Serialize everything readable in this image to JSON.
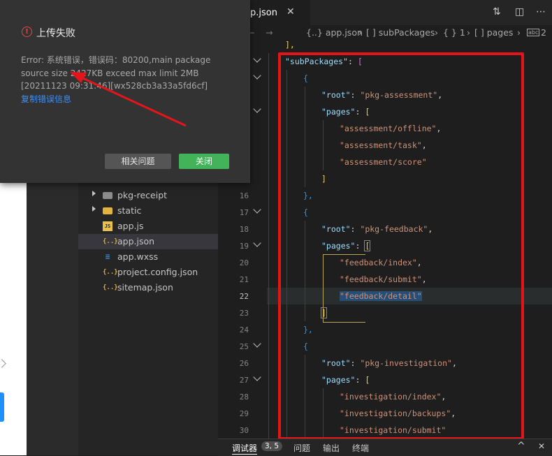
{
  "dialog": {
    "title": "上传失败",
    "message": "Error: 系统错误，错误码：80200,main package source size 2427KB exceed max limit 2MB [20211123 09:31:46][wx528cb3a33a5fd6cf]",
    "copy_link": "复制错误信息",
    "related_button": "相关问题",
    "close_button": "关闭",
    "error_icon": "!"
  },
  "editor": {
    "tab_label": "p.json",
    "tab_close": "✕",
    "breadcrumb": {
      "part1": "{..} app.json",
      "sep1": "›",
      "part2": "[ ] subPackages",
      "sep2": "›",
      "part3": "{ } 1",
      "sep3": "›",
      "part4": "[ ] pages",
      "sep4": "›",
      "part5": "2"
    },
    "breadcrumb_string_icon": "abc"
  },
  "explorer": {
    "items": [
      {
        "label": "pkg-receipt",
        "icon": "folder-icon"
      },
      {
        "label": "static",
        "icon": "folder-icon"
      },
      {
        "label": "app.js",
        "icon": "js-file-icon"
      },
      {
        "label": "app.json",
        "icon": "json-file-icon"
      },
      {
        "label": "app.wxss",
        "icon": "css-file-icon"
      },
      {
        "label": "project.config.json",
        "icon": "json-file-icon"
      },
      {
        "label": "sitemap.json",
        "icon": "json-file-icon"
      }
    ]
  },
  "line_numbers": [
    "16",
    "17",
    "18",
    "19",
    "20",
    "21",
    "22",
    "23",
    "24",
    "25",
    "26",
    "27",
    "28",
    "29",
    "30"
  ],
  "code": {
    "l0_open": "],",
    "l1_key": "\"subPackages\"",
    "l1_colon": ": ",
    "l1_bracket": "[",
    "l2_brace": "{",
    "l3_key": "\"root\"",
    "l3_colon": ": ",
    "l3_val": "\"pkg-assessment\"",
    "l3_comma": ",",
    "l4_key": "\"pages\"",
    "l4_colon": ": ",
    "l4_bracket": "[",
    "l5_val": "\"assessment/offline\"",
    "l5_comma": ",",
    "l6_val": "\"assessment/task\"",
    "l6_comma": ",",
    "l7_val": "\"assessment/score\"",
    "l8_bracket": "]",
    "l9_brace": "},",
    "l10_brace": "{",
    "l11_key": "\"root\"",
    "l11_colon": ": ",
    "l11_val": "\"pkg-feedback\"",
    "l11_comma": ",",
    "l12_key": "\"pages\"",
    "l12_colon": ": ",
    "l12_bracket": "[",
    "l13_val": "\"feedback/index\"",
    "l13_comma": ",",
    "l14_val": "\"feedback/submit\"",
    "l14_comma": ",",
    "l15_val": "\"feedback/detail\"",
    "l16_bracket": "]",
    "l17_brace": "},",
    "l18_brace": "{",
    "l19_key": "\"root\"",
    "l19_colon": ": ",
    "l19_val": "\"pkg-investigation\"",
    "l19_comma": ",",
    "l20_key": "\"pages\"",
    "l20_colon": ": ",
    "l20_bracket": "[",
    "l21_val": "\"investigation/index\"",
    "l21_comma": ",",
    "l22_val": "\"investigation/backups\"",
    "l22_comma": ",",
    "l23_val": "\"investigation/submit\""
  },
  "bottom_panel": {
    "debugger": "调试器",
    "badge": "3, 5",
    "issues": "问题",
    "output": "输出",
    "terminal": "终端",
    "up_icon": "^",
    "close_icon": "✕"
  },
  "colors": {
    "annotation_red": "#e3151a",
    "accent_blue": "#1e90ff",
    "close_green": "#43b35a",
    "json_key": "#9cdcfe",
    "json_string": "#ce9178"
  }
}
